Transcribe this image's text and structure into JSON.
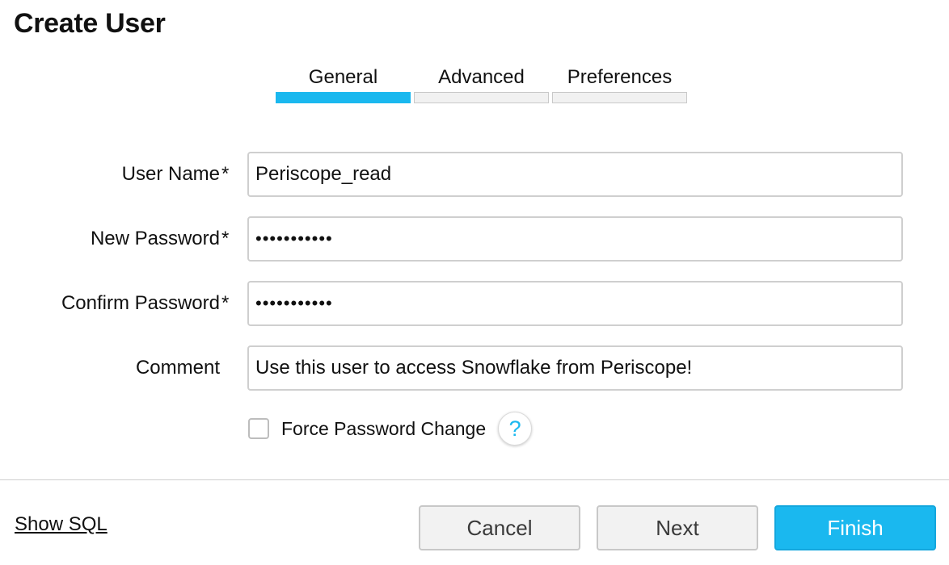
{
  "dialog": {
    "title": "Create User"
  },
  "steps": [
    {
      "label": "General",
      "active": true
    },
    {
      "label": "Advanced",
      "active": false
    },
    {
      "label": "Preferences",
      "active": false
    }
  ],
  "form": {
    "required_marker": "*",
    "username": {
      "label": "User Name",
      "value": "Periscope_read"
    },
    "new_password": {
      "label": "New Password",
      "value": "•••••••••••"
    },
    "confirm_password": {
      "label": "Confirm Password",
      "value": "•••••••••••"
    },
    "comment": {
      "label": "Comment",
      "value": "Use this user to access Snowflake from Periscope!"
    },
    "force_password_change": {
      "label": "Force Password Change",
      "checked": false
    },
    "help_glyph": "?"
  },
  "footer": {
    "show_sql": "Show SQL",
    "cancel": "Cancel",
    "next": "Next",
    "finish": "Finish"
  },
  "colors": {
    "accent": "#1ab8ef",
    "input_border": "#cfcfcf",
    "inactive_step": "#f1f1f1"
  },
  "icons": {
    "help": "question-mark-icon",
    "checkbox": "checkbox-unchecked-icon"
  }
}
